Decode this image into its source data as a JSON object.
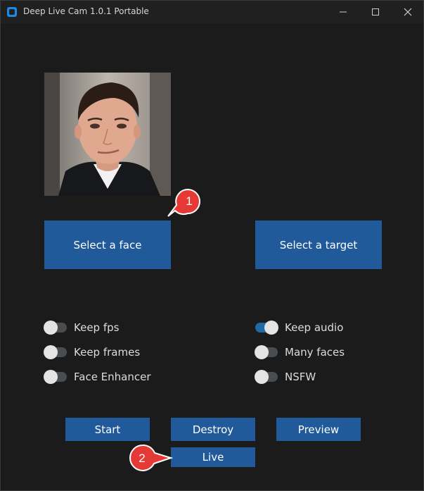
{
  "window": {
    "title": "Deep Live Cam 1.0.1 Portable",
    "accent_color": "#1e88e5",
    "controls": [
      "minimize-icon",
      "maximize-icon",
      "close-icon"
    ]
  },
  "buttons": {
    "select_face": "Select a face",
    "select_target": "Select a target",
    "start": "Start",
    "destroy": "Destroy",
    "preview": "Preview",
    "live": "Live"
  },
  "switches": {
    "keep_fps": {
      "label": "Keep fps",
      "on": false
    },
    "keep_frames": {
      "label": "Keep frames",
      "on": false
    },
    "face_enhancer": {
      "label": "Face Enhancer",
      "on": false
    },
    "keep_audio": {
      "label": "Keep audio",
      "on": true
    },
    "many_faces": {
      "label": "Many faces",
      "on": false
    },
    "nsfw": {
      "label": "NSFW",
      "on": false
    }
  },
  "annotations": {
    "callout_1": "1",
    "callout_2": "2",
    "color": "#e53935"
  },
  "colors": {
    "button": "#215a9a",
    "switch_on": "#1f6aa5",
    "background": "#1b1b1b"
  }
}
